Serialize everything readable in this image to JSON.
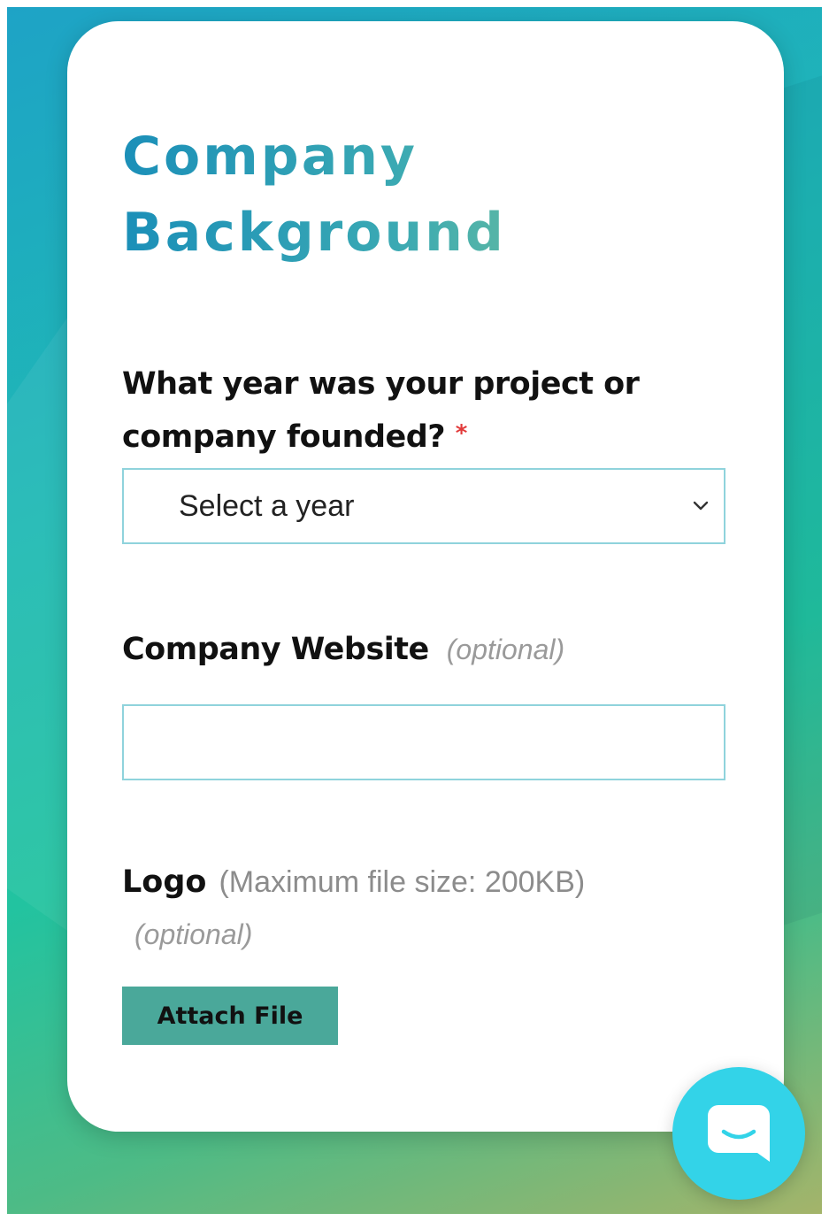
{
  "form": {
    "title": "Company Background",
    "founded_question": "What year was your project or company founded?",
    "required_marker": "*",
    "year_select": {
      "value": "Select a year"
    },
    "website": {
      "label": "Company Website",
      "optional": "(optional)",
      "value": ""
    },
    "logo": {
      "label": "Logo",
      "hint": "(Maximum file size: 200KB)",
      "optional": "(optional)",
      "attach_label": "Attach File"
    }
  },
  "colors": {
    "accent": "#4aa89a",
    "input_border": "#8fd3dc",
    "required": "#e23a3a",
    "chat_launcher": "#33d3e8"
  },
  "icons": {
    "select_caret": "chevron-down-icon",
    "chat": "chat-bubble-icon"
  }
}
